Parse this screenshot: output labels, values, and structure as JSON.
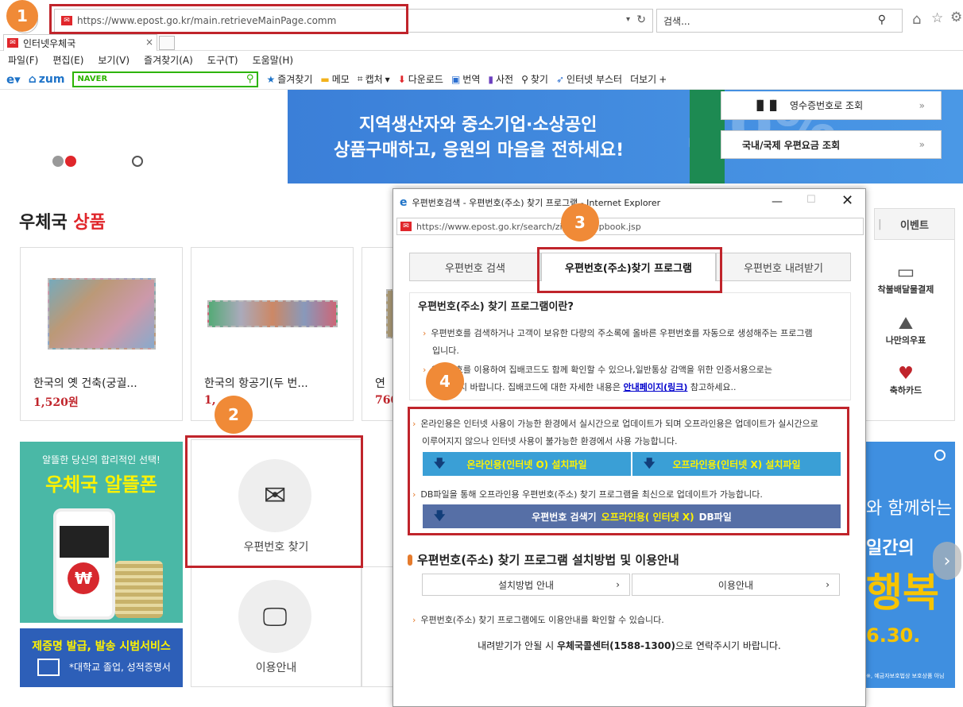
{
  "browser": {
    "url": "https://www.epost.go.kr/main.retrieveMainPage.comm",
    "search_placeholder": "검색...",
    "tab_title": "인터넷우체국",
    "menu": [
      "파일(F)",
      "편집(E)",
      "보기(V)",
      "즐겨찾기(A)",
      "도구(T)",
      "도움말(H)"
    ],
    "toolbar": {
      "zum": "zum",
      "naver": "NAVER",
      "items": [
        "즐겨찾기",
        "메모",
        "캡처",
        "다운로드",
        "번역",
        "사전",
        "찾기",
        "인터넷 부스터",
        "더보기"
      ]
    }
  },
  "hero": {
    "line1": "지역생산자와 중소기업·소상공인",
    "line2": "상품구매하고, 응원의 마음을 전하세요!",
    "quick1": "영수증번호로 조회",
    "quick2": "국내/국제 우편요금 조회",
    "deco": "30%"
  },
  "products": {
    "title_a": "우체국",
    "title_b": "상품",
    "items": [
      {
        "name": "한국의 옛 건축(궁궐...",
        "price": "1,520원"
      },
      {
        "name": "한국의 항공기(두 번...",
        "price": "1,"
      },
      {
        "name": "연",
        "price": "760"
      }
    ]
  },
  "side": {
    "event": "이벤트",
    "icons": [
      "착불배달물결제",
      "나만의우표",
      "축하카드"
    ]
  },
  "banners": {
    "alddeul_sub": "알뜰한 당신의 합리적인 선택!",
    "alddeul_title": "우체국 알뜰폰",
    "cert_title_a": "제증명 발급, 발송 시범서비스",
    "cert_sub": "*대학교 졸업, 성적증명서",
    "right_text1": "와 함께하는",
    "right_text2": "일간의",
    "right_text3": "행복",
    "right_text4": "6.30.",
    "right_small": "※, 예금자보호법상 보호상품 아님"
  },
  "tiles": {
    "postcode": "우편번호 찾기",
    "guide": "이용안내"
  },
  "popup": {
    "title": "우편번호검색 - 우편번호(주소) 찾기 프로그램 - Internet Explorer",
    "url": "https://www.epost.go.kr/search/zipcode/zipbook.jsp",
    "tabs": [
      "우편번호 검색",
      "우편번호(주소)찾기 프로그램",
      "우편번호 내려받기"
    ],
    "heading": "우편번호(주소) 찾기 프로그램이란?",
    "desc1": "우편번호를 검색하거나 고객이 보유한 다량의 주소록에 올바른 우편번호를 자동으로 생성해주는 프로그램",
    "desc1b": "입니다.",
    "desc2": "우편번호를 이용하여 집배코드도 함께 확인할 수 있으나,일반통상 감액을 위한 인증서용으로는",
    "desc2b": "이점 양지 바랍니다. 집배코드에 대한 자세한 내용은",
    "desc2link": "안내페이지(링크)",
    "desc2c": "참고하세요..",
    "online_note": "온라인용은 인터넷 사용이 가능한 환경에서 실시간으로 업데이트가 되며 오프라인용은 업데이트가 실시간으로",
    "online_note2": "이루어지지 않으나 인터넷 사용이 불가능한 환경에서 사용 가능합니다.",
    "btn_online": "온라인용(인터넷 O) 설치파일",
    "btn_offline": "오프라인용(인터넷 X) 설치파일",
    "db_note": "DB파일을 통해 오프라인용 우편번호(주소) 찾기 프로그램을 최신으로 업데이트가 가능합니다.",
    "btn_db_a": "우편번호 검색기",
    "btn_db_b": "오프라인용( 인터넷 X)",
    "btn_db_c": "DB파일",
    "section2": "우편번호(주소) 찾기 프로그램 설치방법 및 이용안내",
    "btn_install": "설치방법 안내",
    "btn_use": "이용안내",
    "note3": "우편번호(주소) 찾기 프로그램에도 이용안내를 확인할 수 있습니다.",
    "contact_a": "내려받기가 안될 시",
    "contact_b": "우체국콜센터(1588-1300)",
    "contact_c": "으로 연락주시기 바랍니다."
  },
  "badges": [
    "1",
    "2",
    "3",
    "4"
  ]
}
